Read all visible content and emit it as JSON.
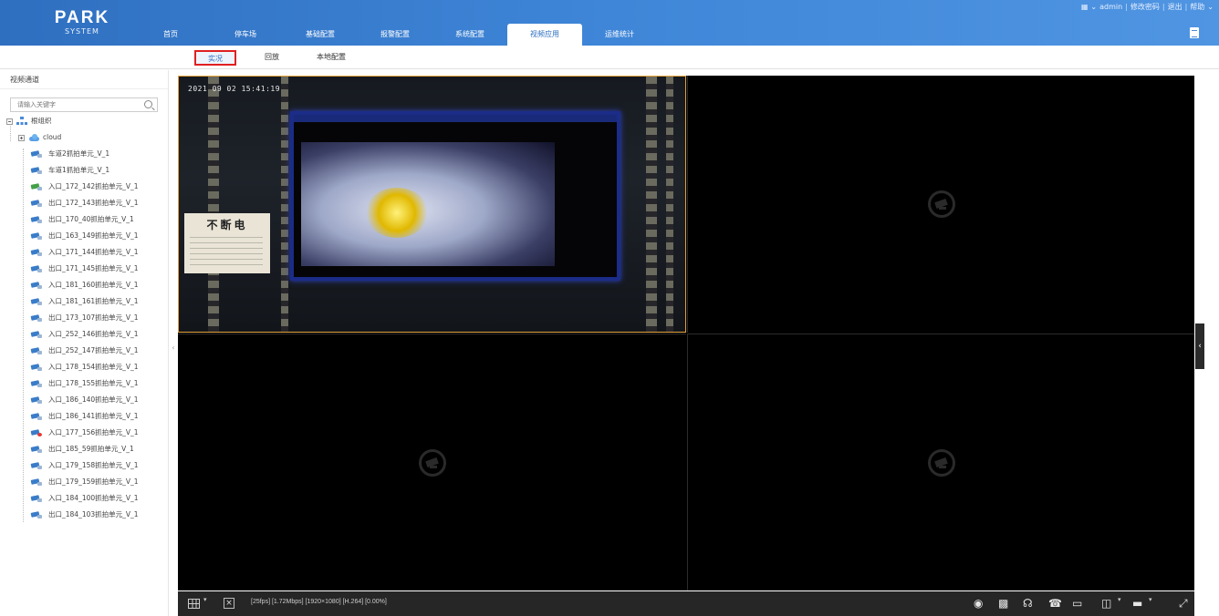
{
  "header": {
    "logo_line1": "PARK",
    "logo_line2": "SYSTEM",
    "tabs": [
      {
        "label": "首页"
      },
      {
        "label": "停车场"
      },
      {
        "label": "基础配置"
      },
      {
        "label": "报警配置"
      },
      {
        "label": "系统配置"
      },
      {
        "label": "视频应用"
      },
      {
        "label": "运维统计"
      }
    ],
    "active_tab": "视频应用",
    "user": "admin",
    "links": [
      "修改密码",
      "退出",
      "帮助"
    ]
  },
  "subtabs": [
    {
      "label": "实况"
    },
    {
      "label": "回放"
    },
    {
      "label": "本地配置"
    }
  ],
  "sidebar": {
    "title": "视频通道",
    "search_placeholder": "请输入关键字",
    "root": "根组织",
    "group": "cloud",
    "channels": [
      {
        "label": "车道2抓拍单元_V_1",
        "status": "online"
      },
      {
        "label": "车道1抓拍单元_V_1",
        "status": "online"
      },
      {
        "label": "入口_172_142抓拍单元_V_1",
        "status": "active"
      },
      {
        "label": "出口_172_143抓拍单元_V_1",
        "status": "online"
      },
      {
        "label": "出口_170_40抓拍单元_V_1",
        "status": "online"
      },
      {
        "label": "出口_163_149抓拍单元_V_1",
        "status": "online"
      },
      {
        "label": "入口_171_144抓拍单元_V_1",
        "status": "online"
      },
      {
        "label": "出口_171_145抓拍单元_V_1",
        "status": "online"
      },
      {
        "label": "入口_181_160抓拍单元_V_1",
        "status": "online"
      },
      {
        "label": "入口_181_161抓拍单元_V_1",
        "status": "online"
      },
      {
        "label": "出口_173_107抓拍单元_V_1",
        "status": "online"
      },
      {
        "label": "入口_252_146抓拍单元_V_1",
        "status": "online"
      },
      {
        "label": "出口_252_147抓拍单元_V_1",
        "status": "online"
      },
      {
        "label": "入口_178_154抓拍单元_V_1",
        "status": "online"
      },
      {
        "label": "出口_178_155抓拍单元_V_1",
        "status": "online"
      },
      {
        "label": "入口_186_140抓拍单元_V_1",
        "status": "online"
      },
      {
        "label": "出口_186_141抓拍单元_V_1",
        "status": "online"
      },
      {
        "label": "入口_177_156抓拍单元_V_1",
        "status": "alarm"
      },
      {
        "label": "出口_185_59抓拍单元_V_1",
        "status": "online"
      },
      {
        "label": "入口_179_158抓拍单元_V_1",
        "status": "online"
      },
      {
        "label": "出口_179_159抓拍单元_V_1",
        "status": "online"
      },
      {
        "label": "入口_184_100抓拍单元_V_1",
        "status": "online"
      },
      {
        "label": "出口_184_103抓拍单元_V_1",
        "status": "online"
      }
    ]
  },
  "video": {
    "timestamp": "2021 09 02 15:41:19",
    "sign_text": "不断电",
    "status_line": "[25fps] [1.72Mbps] [1920×1080] [H.264] [0.00%]"
  },
  "colors": {
    "header_blue": "#3f86d8",
    "active_border": "#e6a23c",
    "highlight_red": "#e02020"
  },
  "toolbar_icons": [
    "grid-layout-icon",
    "close-all-icon",
    "snapshot-icon",
    "record-icon",
    "audio-icon",
    "talk-icon",
    "display-icon",
    "stream-icon",
    "window-ratio-icon",
    "fullscreen-icon"
  ]
}
